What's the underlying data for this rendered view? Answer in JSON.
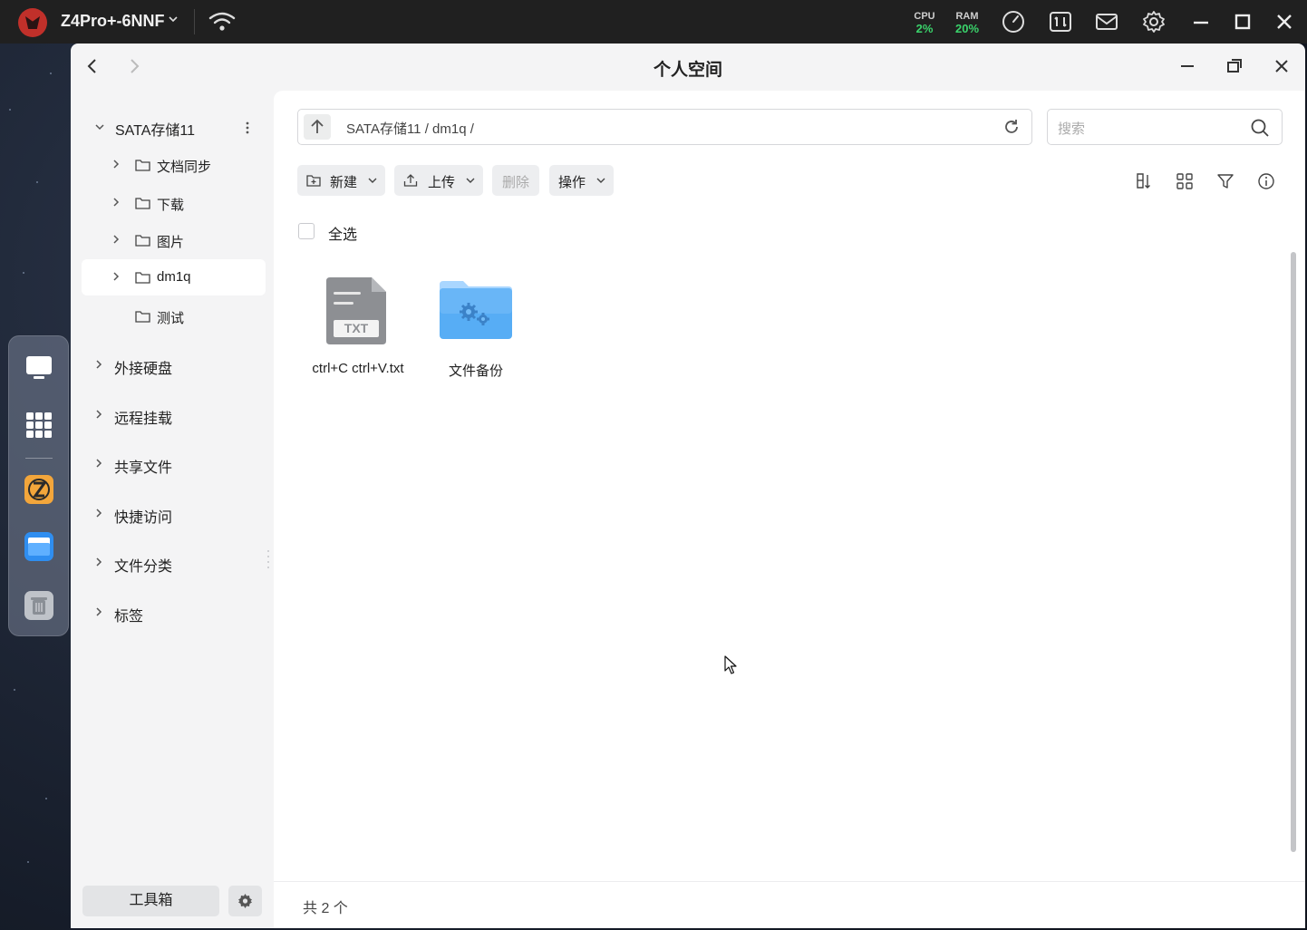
{
  "system_bar": {
    "device_name": "Z4Pro+-6NNF",
    "cpu_label": "CPU",
    "cpu_value": "2%",
    "ram_label": "RAM",
    "ram_value": "20%",
    "accent_green": "#3ad36b"
  },
  "dock": {
    "items": [
      "desktop-icon",
      "app-grid-icon",
      "app-store-icon",
      "file-manager-icon",
      "trash-icon"
    ]
  },
  "window": {
    "title": "个人空间"
  },
  "sidebar": {
    "storage_root": "SATA存储11",
    "folders": [
      {
        "label": "文档同步",
        "expandable": true
      },
      {
        "label": "下载",
        "expandable": true
      },
      {
        "label": "图片",
        "expandable": true
      },
      {
        "label": "dm1q",
        "expandable": true,
        "selected": true
      },
      {
        "label": "测试",
        "expandable": false
      }
    ],
    "sections": [
      "外接硬盘",
      "远程挂载",
      "共享文件",
      "快捷访问",
      "文件分类",
      "标签"
    ],
    "toolbox_label": "工具箱"
  },
  "content": {
    "path": "SATA存储11 / dm1q /",
    "search_placeholder": "搜索",
    "toolbar": {
      "new_label": "新建",
      "upload_label": "上传",
      "delete_label": "删除",
      "actions_label": "操作"
    },
    "select_all_label": "全选",
    "files": [
      {
        "name": "ctrl+C ctrl+V.txt",
        "type": "txt",
        "badge": "TXT"
      },
      {
        "name": "文件备份",
        "type": "folder"
      }
    ],
    "footer_count": "共 2 个"
  }
}
